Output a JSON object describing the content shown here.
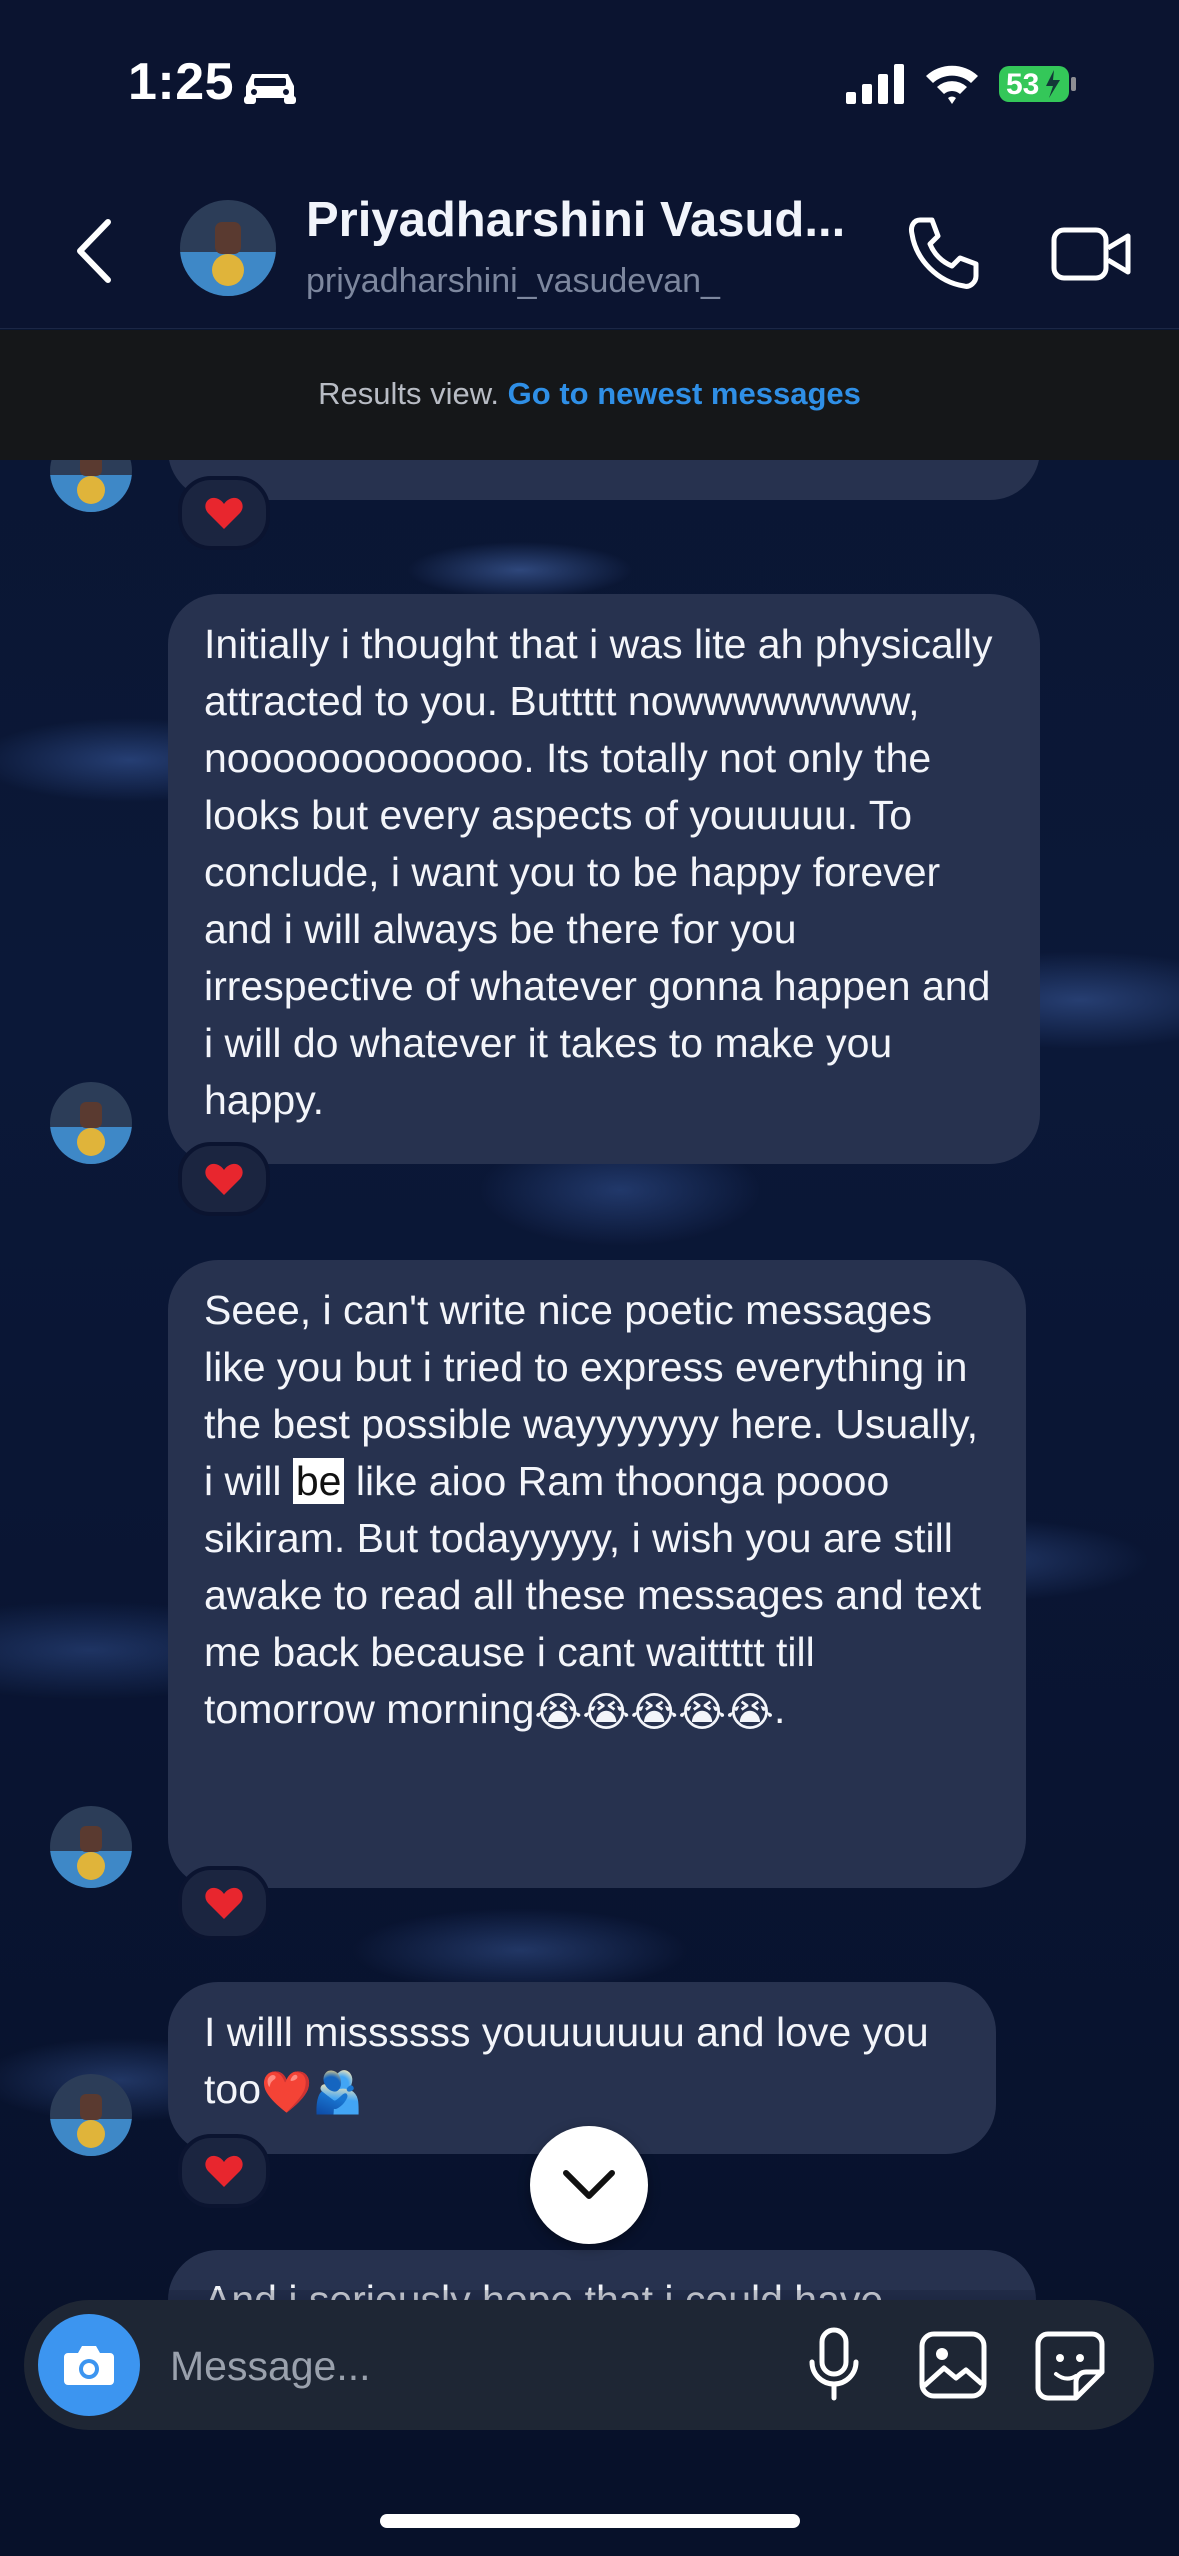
{
  "status_bar": {
    "time": "1:25",
    "battery": "53"
  },
  "header": {
    "name": "Priyadharshini Vasud...",
    "handle": "priyadharshini_vasudevan_"
  },
  "banner": {
    "text": "Results view.",
    "link": "Go to newest messages"
  },
  "messages": [
    {
      "text": "Initially i thought that i was lite ah physically attracted to you. Buttttt nowwwwwwww, nooooooooooooo. Its totally not only the looks but every aspects of youuuuu. To conclude, i want you to be happy forever and i will always be there for you irrespective of whatever gonna happen and i will do whatever it takes to make you happy.",
      "reaction": "heart"
    },
    {
      "text_before": "Seee, i can't write nice poetic messages like you but i tried to express everything in the best possible wayyyyyyy here. Usually, i will",
      "highlight": "be",
      "text_after": "like aioo Ram thoonga poooo sikiram. But todayyyyy, i wish you are still awake to read all these messages and text me back because i cant waittttt till tomorrow morning",
      "emojis": "😭😭😭😭😭",
      "end": ".",
      "reaction": "heart"
    },
    {
      "text": "I willl missssss youuuuuuu and love you too",
      "emojis": "❤️🫂",
      "reaction": "heart"
    },
    {
      "text": "And i seriously hope that i could have"
    }
  ],
  "composer": {
    "placeholder": "Message..."
  },
  "colors": {
    "accent": "#3c95f0",
    "link": "#2f8fe6",
    "bubble": "#27324f",
    "heart": "#e8262e"
  }
}
